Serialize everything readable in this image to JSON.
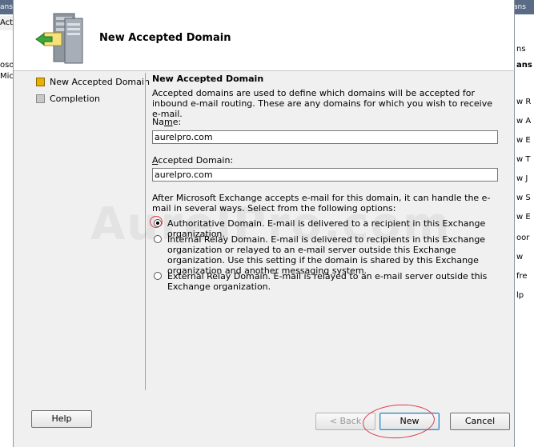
{
  "background_window": {
    "left_fragments": [
      "ans",
      "Acti",
      "oso",
      "Mic"
    ],
    "right_fragments": [
      "ans",
      "ns",
      "ans",
      "w R",
      "w A",
      "w E",
      "w T",
      "w J",
      "w S",
      "w E",
      "oor",
      "w",
      "fre",
      "lp"
    ]
  },
  "wizard": {
    "title": "New Accepted Domain",
    "nav": [
      {
        "label": "New Accepted Domain",
        "active": true
      },
      {
        "label": "Completion",
        "active": false
      }
    ],
    "page_title": "New Accepted Domain",
    "description": "Accepted domains are used to define which domains will be accepted for inbound e-mail routing.  These are any domains for which you wish to receive e-mail.",
    "name_label_mnemonic": "m",
    "name_label_pre": "Na",
    "name_label_post": "e:",
    "name_value": "aurelpro.com",
    "domain_label_mnemonic": "A",
    "domain_label_rest": "ccepted Domain:",
    "domain_value": "aurelpro.com",
    "options_intro": "After Microsoft Exchange accepts e-mail for this domain, it can handle the e-mail in several ways. Select from the following options:",
    "options": [
      {
        "label": "Authoritative Domain. E-mail is delivered to a recipient in this Exchange organization.",
        "checked": true
      },
      {
        "label": "Internal Relay Domain. E-mail is delivered to recipients in this Exchange organization or relayed to an e-mail server outside this Exchange organization. Use this setting if the domain is shared by this Exchange organization and another messaging system.",
        "checked": false
      },
      {
        "label": "External Relay Domain. E-mail is relayed to an e-mail server outside this Exchange organization.",
        "checked": false
      }
    ],
    "buttons": {
      "help": "Help",
      "back": "< Back",
      "new": "New",
      "cancel": "Cancel"
    },
    "watermark": "AurelPro.com"
  },
  "colors": {
    "annotation_red": "#d93a4a",
    "active_step": "#e8b000"
  }
}
